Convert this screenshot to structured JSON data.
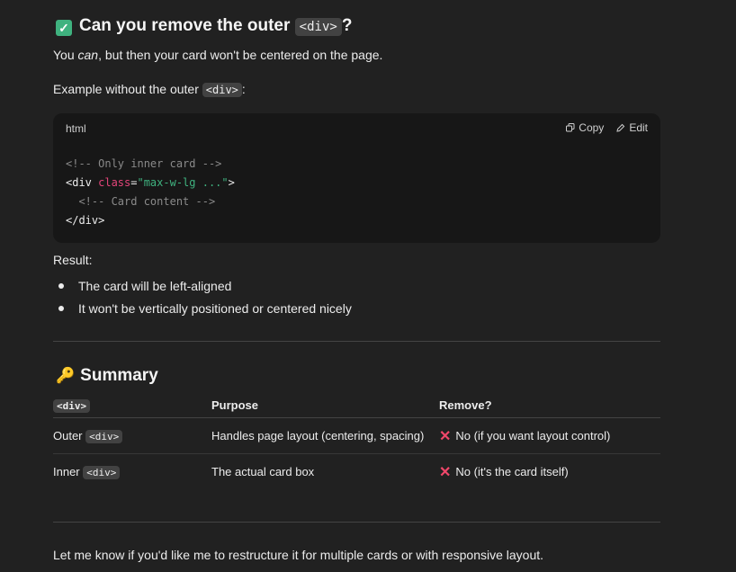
{
  "section1": {
    "check_icon": "white-check-mark-icon",
    "heading_text": "Can you remove the outer",
    "heading_code": "<div>",
    "heading_qmark": "?",
    "p1_pre": "You ",
    "p1_em": "can",
    "p1_post": ", but then your card won't be centered on the page.",
    "p2_pre": "Example without the outer ",
    "p2_code": "<div>",
    "p2_post": ":"
  },
  "codeblock": {
    "lang": "html",
    "copy_label": "Copy",
    "edit_label": "Edit",
    "line1": "<!-- Only inner card -->",
    "line2_open": "<div ",
    "line2_attr": "class",
    "line2_eq": "=",
    "line2_val": "\"max-w-lg ...\"",
    "line2_close": ">",
    "line3": "  <!-- Card content -->",
    "line4": "</div>"
  },
  "result": {
    "label": "Result:",
    "bullets": [
      "The card will be left-aligned",
      "It won't be vertically positioned or centered nicely"
    ]
  },
  "summary": {
    "icon": "key-icon",
    "heading": "Summary",
    "columns": [
      "<div>",
      "Purpose",
      "Remove?"
    ],
    "rows": [
      {
        "label": "Outer ",
        "code": "<div>",
        "purpose": "Handles page layout (centering, spacing)",
        "remove": "No (if you want layout control)"
      },
      {
        "label": "Inner ",
        "code": "<div>",
        "purpose": "The actual card box",
        "remove": "No (it's the card itself)"
      }
    ]
  },
  "footer": {
    "text": "Let me know if you'd like me to restructure it for multiple cards or with responsive layout."
  },
  "colors": {
    "background": "#212121",
    "code_bg": "#171717",
    "accent_green": "#3fb27f",
    "attr_pink": "#e5457a",
    "x_red": "#f0476a"
  }
}
